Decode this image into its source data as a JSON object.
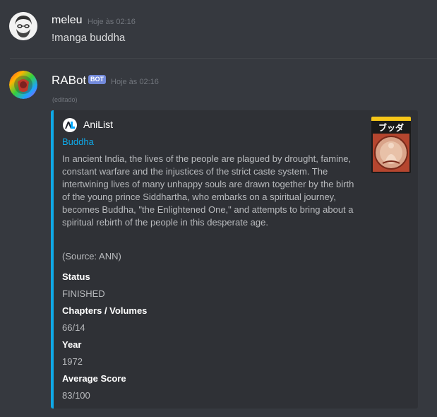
{
  "messages": [
    {
      "username": "meleu",
      "timestamp": "Hoje às 02:16",
      "content": "!manga buddha"
    },
    {
      "username": "RABot",
      "badge": "BOT",
      "timestamp": "Hoje às 02:16",
      "edited": "(editado)"
    }
  ],
  "embed": {
    "author": "AniList",
    "title": "Buddha",
    "description": "In ancient India, the lives of the people are plagued by drought, famine, constant warfare and the injustices of the strict caste system. The intertwining lives of many unhappy souls are drawn together by the birth of the young prince Siddhartha, who embarks on a spiritual journey, becomes Buddha, \"the Enlightened One,\" and attempts to bring about a spiritual rebirth of the people in this desperate age.",
    "source": "(Source: ANN)",
    "fields": [
      {
        "name": "Status",
        "value": "FINISHED"
      },
      {
        "name": "Chapters / Volumes",
        "value": "66/14"
      },
      {
        "name": "Year",
        "value": "1972"
      },
      {
        "name": "Average Score",
        "value": "83/100"
      }
    ],
    "thumbnail_text": "ブッダ",
    "accent_color": "#0fa8e6"
  }
}
